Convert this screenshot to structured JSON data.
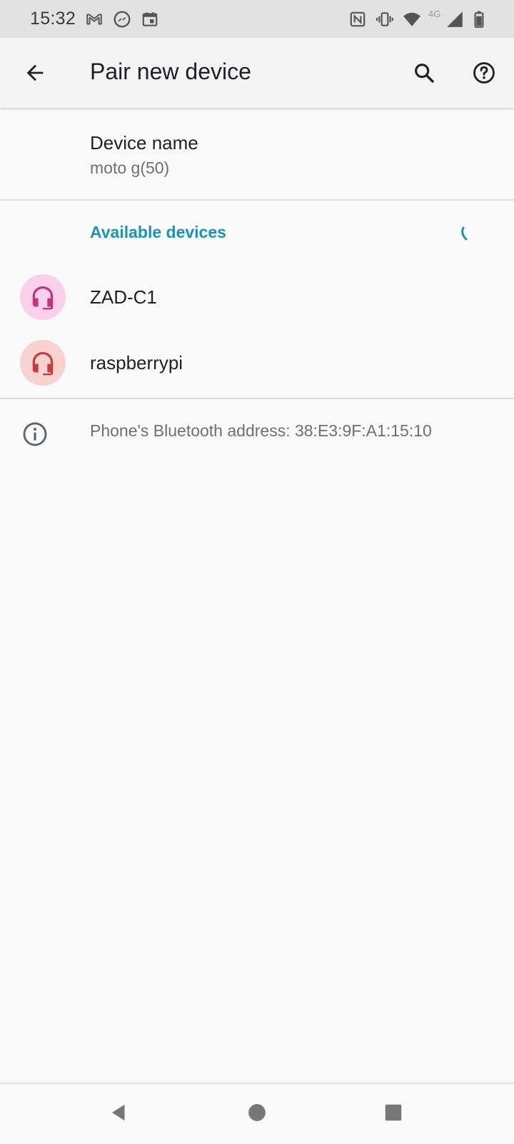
{
  "status_bar": {
    "time": "15:32",
    "network_label": "4G",
    "left_icons": [
      "gmail-icon",
      "messenger-icon",
      "calendar-icon"
    ],
    "right_icons": [
      "nfc-icon",
      "vibrate-icon",
      "wifi-icon",
      "signal-icon",
      "battery-icon"
    ]
  },
  "app_bar": {
    "title": "Pair new device",
    "back_icon": "arrow-back-icon",
    "search_icon": "search-icon",
    "help_icon": "help-icon"
  },
  "device_name": {
    "title": "Device name",
    "value": "moto g(50)"
  },
  "available_devices": {
    "header": "Available devices",
    "accent_color": "#1a93b4",
    "items": [
      {
        "label": "ZAD-C1",
        "icon": "headset-icon",
        "icon_color": "#c2347a",
        "bg_color": "#fbd0eb"
      },
      {
        "label": "raspberrypi",
        "icon": "headset-icon",
        "icon_color": "#c43c3c",
        "bg_color": "#f8d2cf"
      }
    ]
  },
  "footer": {
    "bluetooth_address": "Phone's Bluetooth address: 38:E3:9F:A1:15:10",
    "icon": "info-icon"
  },
  "nav_bar": {
    "buttons": [
      "nav-back-icon",
      "nav-home-icon",
      "nav-recents-icon"
    ]
  }
}
